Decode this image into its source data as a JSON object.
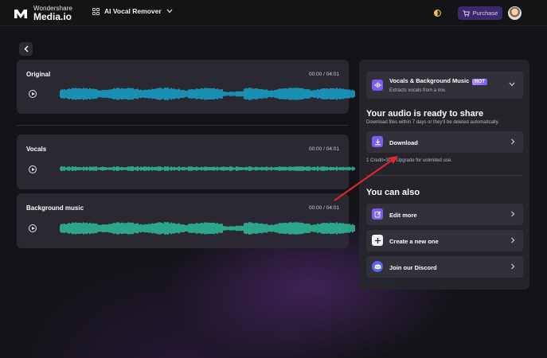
{
  "topbar": {
    "brand_top": "Wondershare",
    "brand_main": "Media.io",
    "tool_name": "AI Vocal Remover",
    "purchase_label": "Purchase"
  },
  "tracks": [
    {
      "title": "Original",
      "current": "00:00",
      "separator": "/",
      "duration": "04:01",
      "color": "#17a9d6"
    },
    {
      "title": "Vocals",
      "current": "00:00",
      "separator": "/",
      "duration": "04:01",
      "color": "#2fc3a0"
    },
    {
      "title": "Background music",
      "current": "00:00",
      "separator": "/",
      "duration": "04:01",
      "color": "#2fc3a0"
    }
  ],
  "panel": {
    "mode": {
      "title": "Vocals & Background Music",
      "badge": "HOT",
      "subtitle": "Extracts vocals from a mix."
    },
    "ready_title": "Your audio is ready to share",
    "ready_subtitle": "Download files within 7 days or they'll be deleted automatically.",
    "download_label": "Download",
    "credit_note": "1 Credit=30s, Upgrade for unlimited use.",
    "also_title": "You can also",
    "actions": [
      {
        "label": "Edit more",
        "icon": "edit-icon"
      },
      {
        "label": "Create a new one",
        "icon": "plus-icon"
      },
      {
        "label": "Join our Discord",
        "icon": "discord-icon"
      }
    ]
  },
  "colors": {
    "accent": "#7b5cf5",
    "original_wave": "#17a9d6",
    "stem_wave": "#2fc3a0",
    "annotation_arrow": "#e0262f"
  }
}
